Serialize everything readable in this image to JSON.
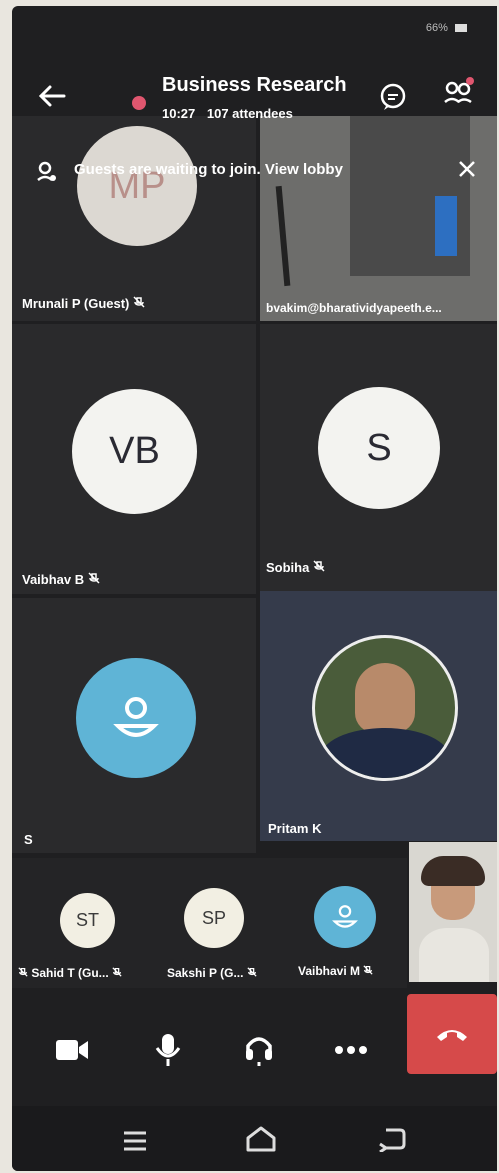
{
  "status": {
    "battery": "66%"
  },
  "header": {
    "title": "Business Research",
    "time": "10:27",
    "attendees": "107 attendees"
  },
  "banner": {
    "text": "Guests are waiting to join. View lobby"
  },
  "video_top": {
    "email": "bvakim@bharatividyapeeth.e..."
  },
  "participants": {
    "mrunali": {
      "name": "Mrunali P (Guest)",
      "initials": "MP"
    },
    "vaibhav": {
      "name": "Vaibhav B",
      "initials": "VB"
    },
    "sobiha": {
      "name": "Sobiha",
      "initials": "S"
    },
    "s": {
      "name": "S"
    },
    "pritam": {
      "name": "Pritam K"
    },
    "sahid": {
      "name": "Sahid T (Gu...",
      "initials": "ST"
    },
    "sakshi": {
      "name": "Sakshi P (G...",
      "initials": "SP"
    },
    "vaibhavi": {
      "name": "Vaibhavi M"
    }
  },
  "colors": {
    "background": "#1f1f21",
    "end_call": "#d64a4a",
    "avatar_blue": "#5fb4d6",
    "recording": "#e0566f"
  },
  "icons": [
    "back-arrow-icon",
    "chat-icon",
    "participants-icon",
    "lobby-icon",
    "close-icon",
    "mic-off-icon",
    "camera-icon",
    "mic-icon",
    "headset-icon",
    "more-icon",
    "end-call-icon",
    "menu-icon",
    "home-icon",
    "back-icon"
  ]
}
